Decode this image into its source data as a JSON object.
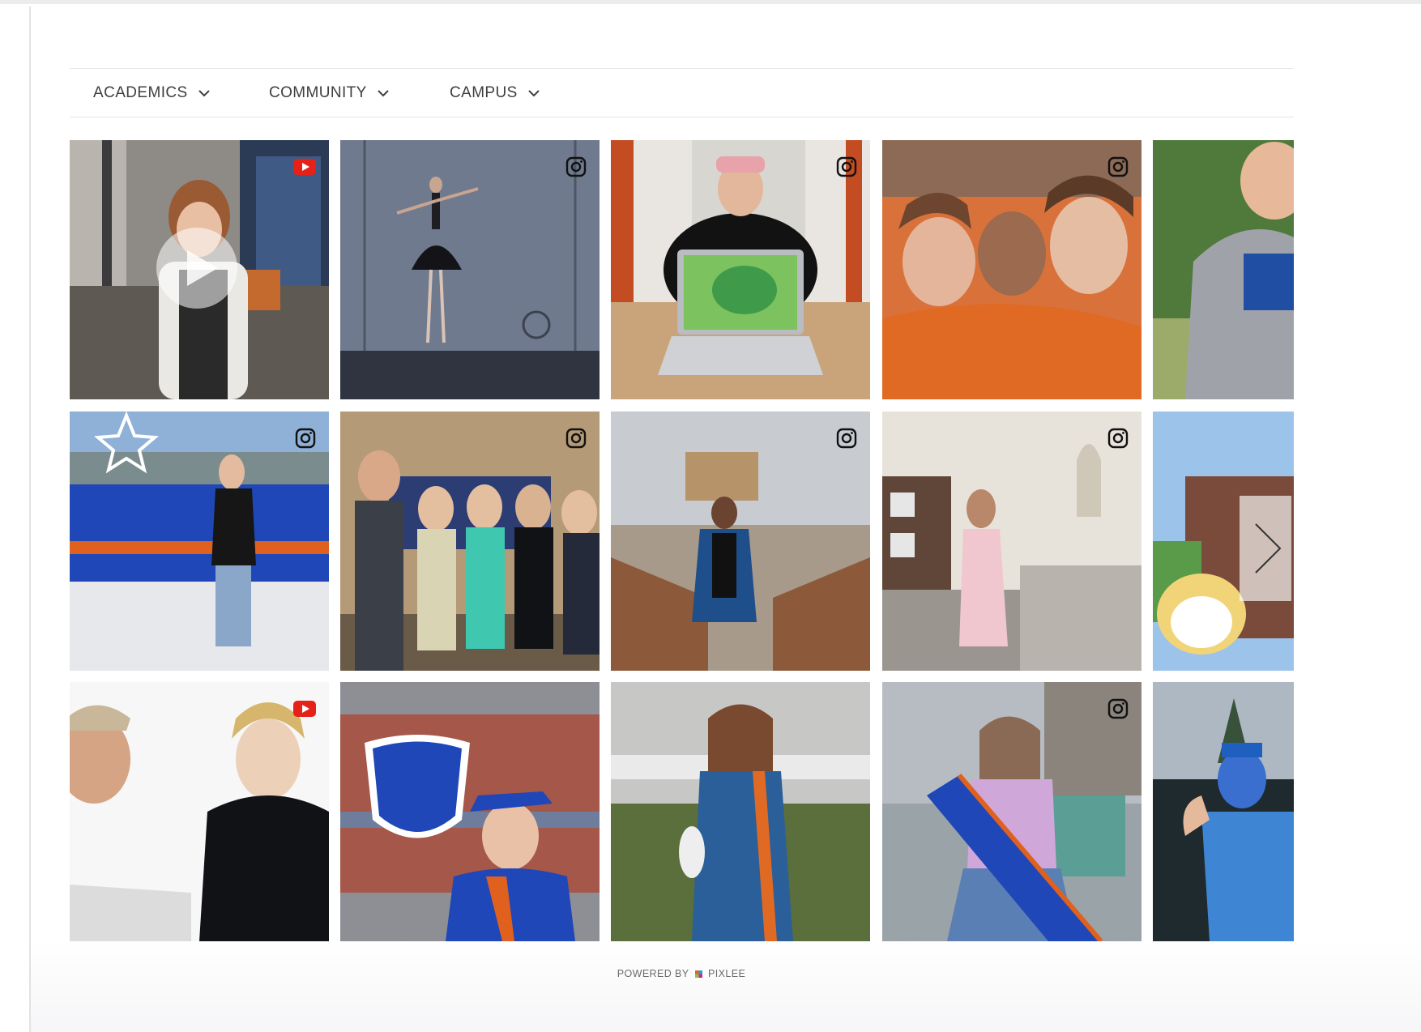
{
  "filters": [
    {
      "label": "ACADEMICS"
    },
    {
      "label": "COMMUNITY"
    },
    {
      "label": "CAMPUS"
    }
  ],
  "gallery": {
    "tiles": [
      {
        "subject": "student speaker in white blazer",
        "source": "youtube-icon"
      },
      {
        "subject": "ballet dancer on stage",
        "source": "instagram-icon"
      },
      {
        "subject": "student with laptop showing cartoon frog",
        "source": "instagram-icon"
      },
      {
        "subject": "fans in orange at stadium",
        "source": "instagram-icon"
      },
      {
        "subject": "student in Boise State hoodie",
        "source": ""
      },
      {
        "subject": "student at blue football field",
        "source": "instagram-icon"
      },
      {
        "subject": "group posing with research poster",
        "source": "instagram-icon"
      },
      {
        "subject": "graduate holding handwritten sign on bridge",
        "source": "instagram-icon"
      },
      {
        "subject": "student on rooftop with capitol behind",
        "source": "instagram-icon"
      },
      {
        "subject": "cartoon dog and campus building",
        "source": ""
      },
      {
        "subject": "two students at a table",
        "source": "youtube-icon"
      },
      {
        "subject": "graduate by marching band logo wall",
        "source": ""
      },
      {
        "subject": "graduate with ice skates",
        "source": ""
      },
      {
        "subject": "student holding Boise State pennant",
        "source": "instagram-icon"
      },
      {
        "subject": "mascot costume fan in blue",
        "source": ""
      }
    ]
  },
  "footer": {
    "powered_by": "POWERED BY",
    "brand": "PIXLEE"
  },
  "colors": {
    "boise_blue": "#0033a0",
    "boise_orange": "#d64309",
    "youtube_red": "#e62117"
  }
}
